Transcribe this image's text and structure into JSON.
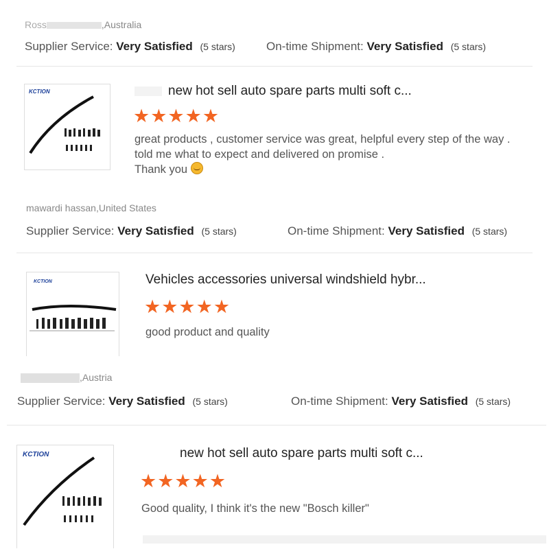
{
  "reviews": [
    {
      "reviewer_suffix": ",Australia",
      "reviewer_prefix_partial": "Ross",
      "supplier_label": "Supplier Service:",
      "supplier_value": "Very Satisfied",
      "supplier_stars": "(5 stars)",
      "shipment_label": "On-time Shipment:",
      "shipment_value": "Very Satisfied",
      "shipment_stars": "(5 stars)"
    },
    {
      "product_brand": "KCTION",
      "product_title": "new hot sell auto spare parts multi soft c...",
      "stars": "★★★★★",
      "comment_lines": [
        "great products , customer service was great, helpful every step of the way .",
        "told me what to expect and delivered on promise .",
        "Thank you"
      ],
      "reviewer": "mawardi hassan,United States",
      "supplier_label": "Supplier Service:",
      "supplier_value": "Very Satisfied",
      "supplier_stars": "(5 stars)",
      "shipment_label": "On-time Shipment:",
      "shipment_value": "Very Satisfied",
      "shipment_stars": "(5 stars)"
    },
    {
      "product_brand": "KCTION",
      "product_title": "Vehicles accessories universal windshield hybr...",
      "stars": "★★★★★",
      "comment": "good product and quality",
      "reviewer_suffix": ",Austria",
      "supplier_label": "Supplier Service:",
      "supplier_value": "Very Satisfied",
      "supplier_stars": "(5 stars)",
      "shipment_label": "On-time Shipment:",
      "shipment_value": "Very Satisfied",
      "shipment_stars": "(5 stars)"
    },
    {
      "product_brand": "KCTION",
      "product_title": "new hot sell auto spare parts multi soft c...",
      "stars": "★★★★★",
      "comment": "Good quality, I think it's the new \"Bosch killer\""
    }
  ],
  "colors": {
    "star": "#f26522",
    "brand": "#1b3f99"
  }
}
